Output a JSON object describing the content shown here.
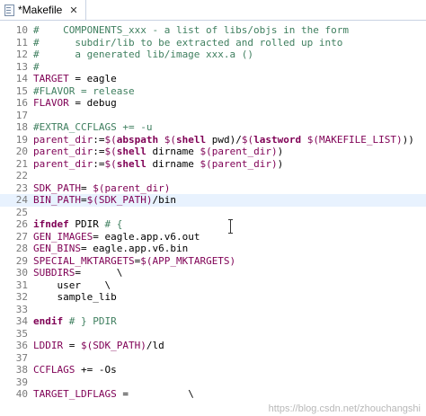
{
  "tab": {
    "title": "*Makefile",
    "close_icon": "✕"
  },
  "watermark": "https://blog.csdn.net/zhouchangshi",
  "lines": [
    {
      "n": "10",
      "tokens": [
        [
          "c-comment",
          "#    COMPONENTS_xxx - a list of libs/objs in the form"
        ]
      ]
    },
    {
      "n": "11",
      "tokens": [
        [
          "c-comment",
          "#      subdir/lib to be extracted and rolled up into"
        ]
      ]
    },
    {
      "n": "12",
      "tokens": [
        [
          "c-comment",
          "#      a generated lib/image xxx.a ()"
        ]
      ]
    },
    {
      "n": "13",
      "tokens": [
        [
          "c-comment",
          "#"
        ]
      ]
    },
    {
      "n": "14",
      "tokens": [
        [
          "c-var",
          "TARGET"
        ],
        [
          "c-plain",
          " = eagle"
        ]
      ]
    },
    {
      "n": "15",
      "tokens": [
        [
          "c-comment",
          "#FLAVOR = release"
        ]
      ]
    },
    {
      "n": "16",
      "tokens": [
        [
          "c-var",
          "FLAVOR"
        ],
        [
          "c-plain",
          " = debug"
        ]
      ]
    },
    {
      "n": "17",
      "tokens": [
        [
          "c-plain",
          ""
        ]
      ]
    },
    {
      "n": "18",
      "tokens": [
        [
          "c-comment",
          "#EXTRA_CCFLAGS += -u"
        ]
      ]
    },
    {
      "n": "19",
      "tokens": [
        [
          "c-var",
          "parent_dir"
        ],
        [
          "c-plain",
          ":="
        ],
        [
          "c-ref",
          "$("
        ],
        [
          "c-fn",
          "abspath"
        ],
        [
          "c-plain",
          " "
        ],
        [
          "c-ref",
          "$("
        ],
        [
          "c-fn",
          "shell"
        ],
        [
          "c-plain",
          " pwd)/"
        ],
        [
          "c-ref",
          "$("
        ],
        [
          "c-fn",
          "lastword"
        ],
        [
          "c-plain",
          " "
        ],
        [
          "c-ref",
          "$(MAKEFILE_LIST)"
        ],
        [
          "c-plain",
          "))"
        ]
      ]
    },
    {
      "n": "20",
      "tokens": [
        [
          "c-var",
          "parent_dir"
        ],
        [
          "c-plain",
          ":="
        ],
        [
          "c-ref",
          "$("
        ],
        [
          "c-fn",
          "shell"
        ],
        [
          "c-plain",
          " dirname "
        ],
        [
          "c-ref",
          "$(parent_dir)"
        ],
        [
          "c-plain",
          ")"
        ]
      ]
    },
    {
      "n": "21",
      "tokens": [
        [
          "c-var",
          "parent_dir"
        ],
        [
          "c-plain",
          ":="
        ],
        [
          "c-ref",
          "$("
        ],
        [
          "c-fn",
          "shell"
        ],
        [
          "c-plain",
          " dirname "
        ],
        [
          "c-ref",
          "$(parent_dir)"
        ],
        [
          "c-plain",
          ")"
        ]
      ]
    },
    {
      "n": "22",
      "tokens": [
        [
          "c-plain",
          ""
        ]
      ]
    },
    {
      "n": "23",
      "tokens": [
        [
          "c-var",
          "SDK_PATH"
        ],
        [
          "c-plain",
          "= "
        ],
        [
          "c-ref",
          "$(parent_dir)"
        ]
      ]
    },
    {
      "n": "24",
      "current": true,
      "tokens": [
        [
          "c-var",
          "BIN_PATH"
        ],
        [
          "c-plain",
          "="
        ],
        [
          "c-ref",
          "$(SDK_PATH)"
        ],
        [
          "c-plain",
          "/bin"
        ]
      ]
    },
    {
      "n": "25",
      "tokens": [
        [
          "c-plain",
          ""
        ]
      ]
    },
    {
      "n": "26",
      "tokens": [
        [
          "c-kw",
          "ifndef"
        ],
        [
          "c-plain",
          " PDIR "
        ],
        [
          "c-comment",
          "# {"
        ]
      ]
    },
    {
      "n": "27",
      "tokens": [
        [
          "c-var",
          "GEN_IMAGES"
        ],
        [
          "c-plain",
          "= eagle.app.v6.out"
        ]
      ]
    },
    {
      "n": "28",
      "tokens": [
        [
          "c-var",
          "GEN_BINS"
        ],
        [
          "c-plain",
          "= eagle.app.v6.bin"
        ]
      ]
    },
    {
      "n": "29",
      "tokens": [
        [
          "c-var",
          "SPECIAL_MKTARGETS"
        ],
        [
          "c-plain",
          "="
        ],
        [
          "c-ref",
          "$(APP_MKTARGETS)"
        ]
      ]
    },
    {
      "n": "30",
      "tokens": [
        [
          "c-var",
          "SUBDIRS"
        ],
        [
          "c-plain",
          "=      \\"
        ]
      ]
    },
    {
      "n": "31",
      "tokens": [
        [
          "c-plain",
          "    user    \\"
        ]
      ]
    },
    {
      "n": "32",
      "tokens": [
        [
          "c-plain",
          "    sample_lib"
        ]
      ]
    },
    {
      "n": "33",
      "tokens": [
        [
          "c-plain",
          ""
        ]
      ]
    },
    {
      "n": "34",
      "tokens": [
        [
          "c-kw",
          "endif"
        ],
        [
          "c-plain",
          " "
        ],
        [
          "c-comment",
          "# } PDIR"
        ]
      ]
    },
    {
      "n": "35",
      "tokens": [
        [
          "c-plain",
          ""
        ]
      ]
    },
    {
      "n": "36",
      "tokens": [
        [
          "c-var",
          "LDDIR"
        ],
        [
          "c-plain",
          " = "
        ],
        [
          "c-ref",
          "$(SDK_PATH)"
        ],
        [
          "c-plain",
          "/ld"
        ]
      ]
    },
    {
      "n": "37",
      "tokens": [
        [
          "c-plain",
          ""
        ]
      ]
    },
    {
      "n": "38",
      "tokens": [
        [
          "c-var",
          "CCFLAGS"
        ],
        [
          "c-plain",
          " += -Os"
        ]
      ]
    },
    {
      "n": "39",
      "tokens": [
        [
          "c-plain",
          ""
        ]
      ]
    },
    {
      "n": "40",
      "tokens": [
        [
          "c-var",
          "TARGET_LDFLAGS"
        ],
        [
          "c-plain",
          " =          \\"
        ]
      ]
    }
  ]
}
